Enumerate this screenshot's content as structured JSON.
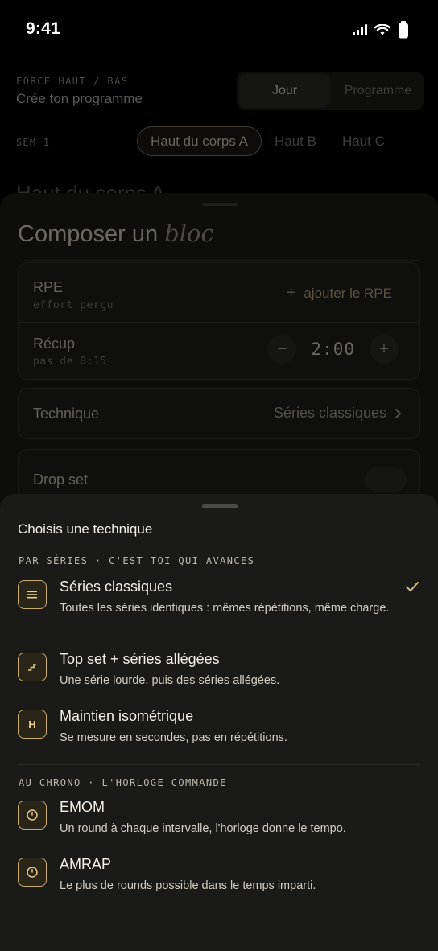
{
  "status_bar": {
    "time": "9:41"
  },
  "background": {
    "eyebrow": "FORCE HAUT / BAS",
    "title": "Crée ton programme",
    "segments": [
      {
        "label": "Jour",
        "active": true
      },
      {
        "label": "Programme",
        "active": false
      }
    ],
    "week_label": "SEM 1",
    "day_chips": [
      {
        "label": "Haut du corps A",
        "active": true
      },
      {
        "label": "Haut B",
        "active": false
      },
      {
        "label": "Haut C",
        "active": false
      }
    ],
    "heading": "Haut du corps A"
  },
  "compose_sheet": {
    "title_plain": "Composer un",
    "title_italic": "bloc",
    "rpe": {
      "label": "RPE",
      "sub": "effort perçu",
      "add_label": "ajouter le RPE"
    },
    "recup": {
      "label": "Récup",
      "sub": "pas de 0:15",
      "value": "2:00"
    },
    "technique": {
      "label": "Technique",
      "value": "Séries classiques"
    },
    "drop_set": {
      "label": "Drop set",
      "enabled": false
    }
  },
  "technique_sheet": {
    "title": "Choisis une technique",
    "sections": [
      {
        "label": "PAR SÉRIES · C'EST TOI QUI AVANCES",
        "options": [
          {
            "title": "Séries classiques",
            "desc": "Toutes les séries identiques : mêmes répétitions, même charge.",
            "icon": "list-icon",
            "glyph": "≡",
            "selected": true
          },
          {
            "title": "Top set + séries allégées",
            "desc": "Une série lourde, puis des séries allégées.",
            "icon": "stairs-icon",
            "glyph": "",
            "selected": false
          },
          {
            "title": "Maintien isométrique",
            "desc": "Se mesure en secondes, pas en répétitions.",
            "icon": "hold-icon",
            "glyph": "H",
            "selected": false
          }
        ]
      },
      {
        "label": "AU CHRONO · L'HORLOGE COMMANDE",
        "options": [
          {
            "title": "EMOM",
            "desc": "Un round à chaque intervalle, l'horloge donne le tempo.",
            "icon": "timer-icon",
            "glyph": "",
            "selected": false
          },
          {
            "title": "AMRAP",
            "desc": "Le plus de rounds possible dans le temps imparti.",
            "icon": "timer-icon",
            "glyph": "",
            "selected": false
          }
        ]
      }
    ]
  },
  "colors": {
    "accent": "#c9ac6e",
    "sheet_bg": "#1a1a19",
    "page_bg": "#000000"
  }
}
